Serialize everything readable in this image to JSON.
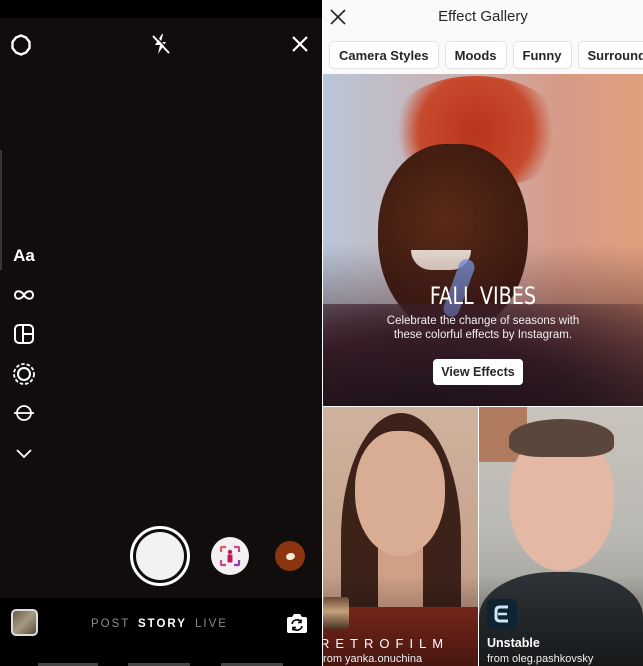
{
  "camera": {
    "top_icons": [
      "settings-icon",
      "flash-off-icon",
      "close-icon"
    ],
    "tools": [
      {
        "name": "create-mode",
        "label": "Aa"
      },
      {
        "name": "boomerang",
        "icon": "infinity-icon"
      },
      {
        "name": "layout",
        "icon": "layout-icon"
      },
      {
        "name": "superzoom",
        "icon": "dashed-circle-icon"
      },
      {
        "name": "level",
        "icon": "level-icon"
      },
      {
        "name": "more",
        "icon": "chevron-down-icon"
      }
    ],
    "modes": {
      "post": "POST",
      "story": "STORY",
      "live": "LIVE"
    },
    "active_mode": "STORY",
    "effects": [
      "face-effect",
      "donut-effect"
    ]
  },
  "gallery": {
    "title": "Effect Gallery",
    "categories": [
      "Camera Styles",
      "Moods",
      "Funny",
      "Surroundings"
    ],
    "featured": {
      "title": "FALL VIBES",
      "description_line1": "Celebrate the change of seasons with",
      "description_line2": "these colorful effects by Instagram.",
      "button": "View Effects"
    },
    "effects": [
      {
        "name": "RETROFILM",
        "by": "from yanka.onuchina"
      },
      {
        "name": "Unstable",
        "by": "from oleg.pashkovsky"
      }
    ]
  }
}
